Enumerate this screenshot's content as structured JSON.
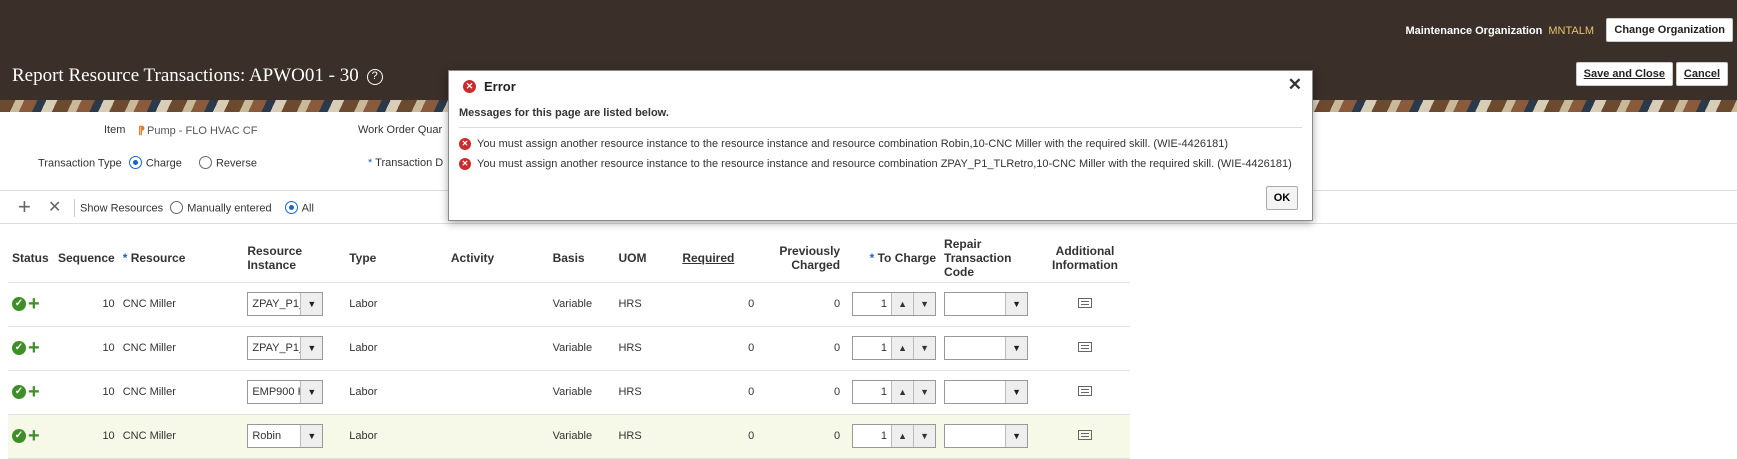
{
  "header": {
    "org_label": "Maintenance Organization",
    "org_value": "MNTALM",
    "change_org": "Change Organization",
    "title": "Report Resource Transactions: APWO01 - 30",
    "help": "?",
    "save_close": "Save and Close",
    "cancel": "Cancel"
  },
  "form": {
    "item_label": "Item",
    "item_value": "Pump - FLO HVAC CF",
    "wo_qty_label": "Work Order Quar",
    "txn_type_label": "Transaction Type",
    "txn_charge": "Charge",
    "txn_reverse": "Reverse",
    "txn_date_label": "Transaction D"
  },
  "toolbar": {
    "add": "+",
    "delete": "✕",
    "show_resources_label": "Show Resources",
    "opt_manual": "Manually entered",
    "opt_all": "All"
  },
  "table": {
    "headers": {
      "status": "Status",
      "sequence": "Sequence",
      "resource": "Resource",
      "resource_instance": "Resource Instance",
      "type": "Type",
      "activity": "Activity",
      "basis": "Basis",
      "uom": "UOM",
      "required": "Required",
      "prev_charged": "Previously Charged",
      "to_charge": "To Charge",
      "repair_code": "Repair Transaction Code",
      "additional": "Additional Information"
    },
    "rows": [
      {
        "sequence": "10",
        "resource": "CNC Miller",
        "instance": "ZPAY_P1_",
        "type": "Labor",
        "basis": "Variable",
        "uom": "HRS",
        "required": "0",
        "prev": "0",
        "to_charge": "1"
      },
      {
        "sequence": "10",
        "resource": "CNC Miller",
        "instance": "ZPAY_P1_",
        "type": "Labor",
        "basis": "Variable",
        "uom": "HRS",
        "required": "0",
        "prev": "0",
        "to_charge": "1"
      },
      {
        "sequence": "10",
        "resource": "CNC Miller",
        "instance": "EMP900 H",
        "type": "Labor",
        "basis": "Variable",
        "uom": "HRS",
        "required": "0",
        "prev": "0",
        "to_charge": "1"
      },
      {
        "sequence": "10",
        "resource": "CNC Miller",
        "instance": "Robin",
        "type": "Labor",
        "basis": "Variable",
        "uom": "HRS",
        "required": "0",
        "prev": "0",
        "to_charge": "1"
      }
    ]
  },
  "dialog": {
    "title": "Error",
    "close": "✕",
    "intro": "Messages for this page are listed below.",
    "messages": [
      "You must assign another resource instance to the resource instance and resource combination Robin,10-CNC Miller with the required skill. (WIE-4426181)",
      "You must assign another resource instance to the resource instance and resource combination ZPAY_P1_TLRetro,10-CNC Miller with the required skill. (WIE-4426181)"
    ],
    "ok": "OK"
  }
}
